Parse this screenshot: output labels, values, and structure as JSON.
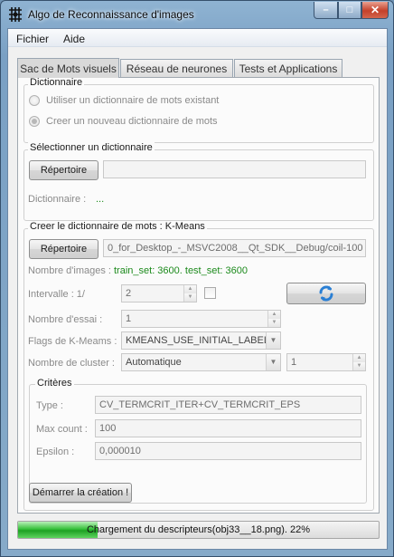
{
  "window": {
    "title": "Algo de Reconnaissance d'images",
    "app_icon": "grid-app-icon",
    "min_glyph": "–",
    "max_glyph": "□",
    "close_glyph": "✕"
  },
  "menu": {
    "items": [
      "Fichier",
      "Aide"
    ]
  },
  "tabs": [
    {
      "label": "Sac de Mots visuels",
      "active": true
    },
    {
      "label": "Réseau de neurones",
      "active": false
    },
    {
      "label": "Tests et Applications",
      "active": false
    }
  ],
  "dictionnaire": {
    "title": "Dictionnaire",
    "option_existing": "Utiliser un dictionnaire de mots existant",
    "option_new": "Creer un nouveau dictionnaire de mots",
    "selected_option": "new"
  },
  "selection": {
    "title": "Sélectionner un dictionnaire",
    "browse_button": "Répertoire",
    "path_value": "",
    "dict_label": "Dictionnaire :",
    "dict_value": "..."
  },
  "kmeans": {
    "title": "Creer le dictionnaire de mots : K-Means",
    "browse_button": "Répertoire",
    "path_value": "0_for_Desktop_-_MSVC2008__Qt_SDK__Debug/coil-100",
    "images_label": "Nombre d'images :",
    "images_value": "train_set: 3600. test_set: 3600",
    "interval_label": "Intervalle : 1/",
    "interval_value": "2",
    "interval_checked": false,
    "attempts_label": "Nombre d'essai :",
    "attempts_value": "1",
    "flags_label": "Flags de K-Meams :",
    "flags_value": "KMEANS_USE_INITIAL_LABELS",
    "clusters_label": "Nombre de cluster :",
    "clusters_mode": "Automatique",
    "clusters_value": "1",
    "criteria": {
      "title": "Critères",
      "type_label": "Type :",
      "type_value": "CV_TERMCRIT_ITER+CV_TERMCRIT_EPS",
      "max_count_label": "Max count :",
      "max_count_value": "100",
      "epsilon_label": "Epsilon :",
      "epsilon_value": "0,000010"
    },
    "start_button": "Démarrer la création !"
  },
  "status": {
    "text": "Chargement du descripteurs(obj33__18.png). 22%",
    "progress": 0.22,
    "progress_color": "#2bb330"
  },
  "colors": {
    "green_text": "#1c8a1c",
    "accent_blue": "#2a7fd4"
  }
}
